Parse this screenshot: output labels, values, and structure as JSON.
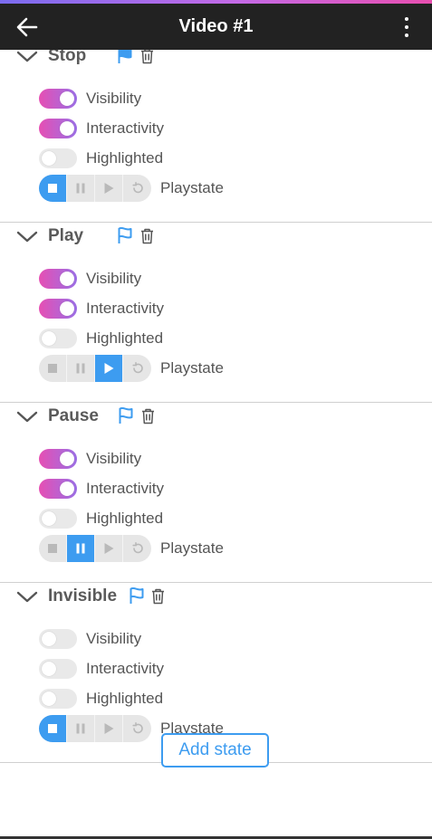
{
  "header": {
    "title": "Video #1",
    "back_icon": "arrow-left-icon",
    "menu_icon": "more-vertical-icon"
  },
  "colors": {
    "accent_blue": "#3d9cf0",
    "toggle_on_start": "#e64fb3",
    "toggle_on_end": "#9b6fe6",
    "header_bg": "#222222"
  },
  "labels": {
    "visibility": "Visibility",
    "interactivity": "Interactivity",
    "highlighted": "Highlighted",
    "playstate": "Playstate"
  },
  "states": [
    {
      "name": "Stop",
      "flag_filled": true,
      "visibility": true,
      "interactivity": true,
      "highlighted": false,
      "playstate": "stop"
    },
    {
      "name": "Play",
      "flag_filled": false,
      "visibility": true,
      "interactivity": true,
      "highlighted": false,
      "playstate": "play"
    },
    {
      "name": "Pause",
      "flag_filled": false,
      "visibility": true,
      "interactivity": true,
      "highlighted": false,
      "playstate": "pause"
    },
    {
      "name": "Invisible",
      "flag_filled": false,
      "visibility": false,
      "interactivity": false,
      "highlighted": false,
      "playstate": "stop"
    }
  ],
  "add_state_label": "Add state"
}
